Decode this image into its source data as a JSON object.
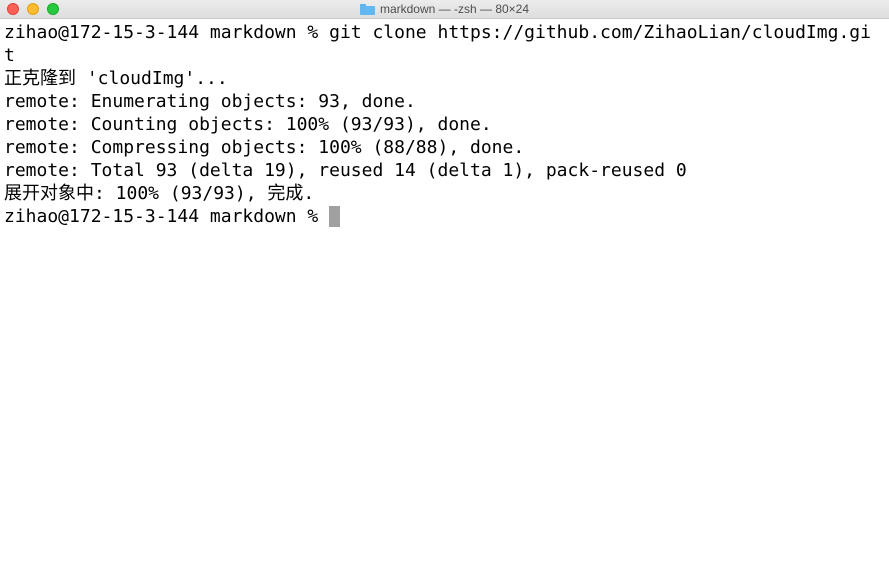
{
  "window": {
    "title": "markdown — -zsh — 80×24",
    "folder_icon": "folder-icon"
  },
  "colors": {
    "close": "#fe5f57",
    "minimize": "#febc2e",
    "maximize": "#28c840",
    "background": "#ffffff",
    "text": "#000000",
    "cursor": "#a0a0a0"
  },
  "terminal": {
    "lines": [
      "zihao@172-15-3-144 markdown % git clone https://github.com/ZihaoLian/cloudImg.gi",
      "t",
      "正克隆到 'cloudImg'...",
      "remote: Enumerating objects: 93, done.",
      "remote: Counting objects: 100% (93/93), done.",
      "remote: Compressing objects: 100% (88/88), done.",
      "remote: Total 93 (delta 19), reused 14 (delta 1), pack-reused 0",
      "展开对象中: 100% (93/93), 完成."
    ],
    "prompt": "zihao@172-15-3-144 markdown % "
  }
}
